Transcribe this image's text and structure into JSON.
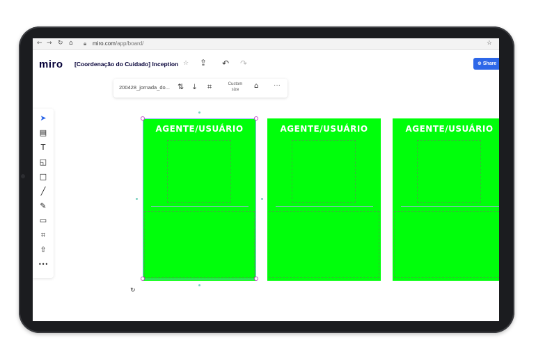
{
  "browser": {
    "back": "←",
    "forward": "→",
    "reload": "↻",
    "home": "⌂",
    "lock": "🔒",
    "url_host": "miro.com",
    "url_path": "/app/board/",
    "bookmark": "☆"
  },
  "header": {
    "logo": "miro",
    "board_title": "[Coordenação do Cuidado] Inception",
    "star": "☆",
    "export_icon": "⇪",
    "undo_icon": "↶",
    "redo_icon": "↷",
    "share_label": "Share",
    "share_icon": "🌐"
  },
  "context_toolbar": {
    "file_name": "200428_jornada_do...",
    "swap_icon": "⇅",
    "download_icon": "⤓",
    "crop_icon": "⌗",
    "size_line1": "Custom",
    "size_line2": "size",
    "lock_icon": "🔓",
    "more": "···"
  },
  "tools": [
    {
      "name": "select-tool",
      "glyph": "➤"
    },
    {
      "name": "templates-tool",
      "glyph": "▤"
    },
    {
      "name": "text-tool",
      "glyph": "T"
    },
    {
      "name": "sticky-note-tool",
      "glyph": "◱"
    },
    {
      "name": "shape-tool",
      "glyph": "□"
    },
    {
      "name": "line-tool",
      "glyph": "╱"
    },
    {
      "name": "pen-tool",
      "glyph": "✎"
    },
    {
      "name": "comment-tool",
      "glyph": "▭"
    },
    {
      "name": "frame-tool",
      "glyph": "⌗"
    },
    {
      "name": "upload-tool",
      "glyph": "⇧"
    },
    {
      "name": "more-tools",
      "glyph": "•••"
    }
  ],
  "cards": [
    {
      "title": "AGENTE/USUÁRIO"
    },
    {
      "title": "AGENTE/USUÁRIO"
    },
    {
      "title": "AGENTE/USUÁRIO"
    }
  ],
  "colors": {
    "card_green": "#00ff0b",
    "share_blue": "#2d67e8",
    "selection_handle": "#c04bc8"
  }
}
